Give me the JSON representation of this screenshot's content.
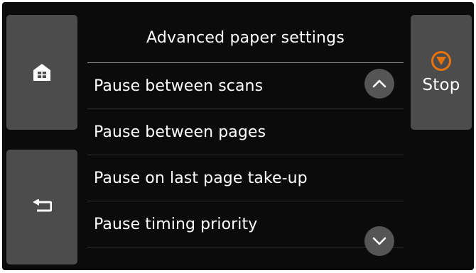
{
  "header": {
    "title": "Advanced paper settings"
  },
  "side_buttons": {
    "home_icon": "home-icon",
    "back_icon": "back-arrow-icon",
    "stop_label": "Stop",
    "stop_icon": "stop-circle-icon"
  },
  "menu": {
    "items": [
      {
        "label": "Pause between scans"
      },
      {
        "label": "Pause between pages"
      },
      {
        "label": "Pause on last page take-up"
      },
      {
        "label": "Pause timing priority"
      }
    ],
    "scroll_up_icon": "chevron-up-icon",
    "scroll_down_icon": "chevron-down-icon"
  },
  "colors": {
    "screen_background": "#0b0b0b",
    "side_button": "#4c4c4c",
    "stop_accent": "#e8730c",
    "text": "#ffffff",
    "scroll_button": "#555555"
  }
}
